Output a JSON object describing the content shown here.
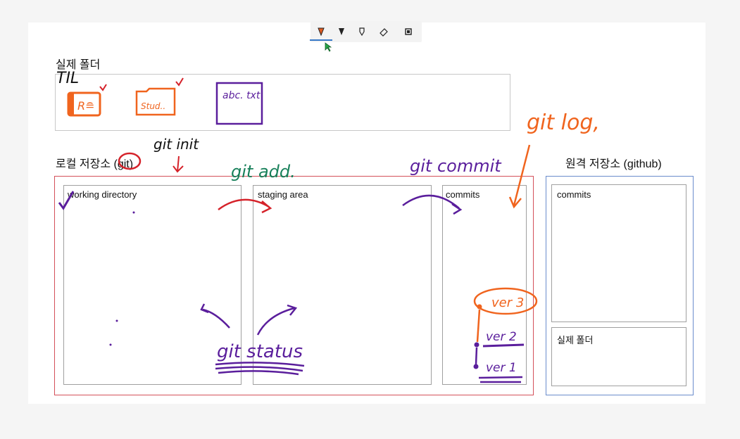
{
  "toolbar": {
    "tools": [
      "pen-red-icon",
      "pen-black-icon",
      "highlighter-icon",
      "eraser-icon",
      "lasso-icon"
    ]
  },
  "real_folder": {
    "title": "실제 폴더",
    "handwritten": "TIL",
    "files": [
      {
        "name": "R",
        "label": "R≘"
      },
      {
        "name": "folder",
        "label": "Stud.."
      },
      {
        "name": "txt",
        "label": "abc. txt"
      }
    ]
  },
  "local_repo": {
    "title": "로컬 저장소 (git)",
    "sections": [
      "working directory",
      "staging area",
      "commits"
    ]
  },
  "remote_repo": {
    "title": "원격 저장소 (github)",
    "sections": [
      "commits",
      "실제 폴더"
    ]
  },
  "annotations": {
    "git_init": "git init",
    "git_add": "git add.",
    "git_commit": "git commit",
    "git_log": "git log,",
    "git_status": "git status",
    "ver3": "ver 3",
    "ver2": "ver 2",
    "ver1": "ver 1"
  },
  "colors": {
    "orange": "#f0641e",
    "purple": "#5a1e9c",
    "green": "#17805a",
    "red": "#d5222a",
    "local_border": "#d4505a",
    "remote_border": "#5a7dc8"
  }
}
